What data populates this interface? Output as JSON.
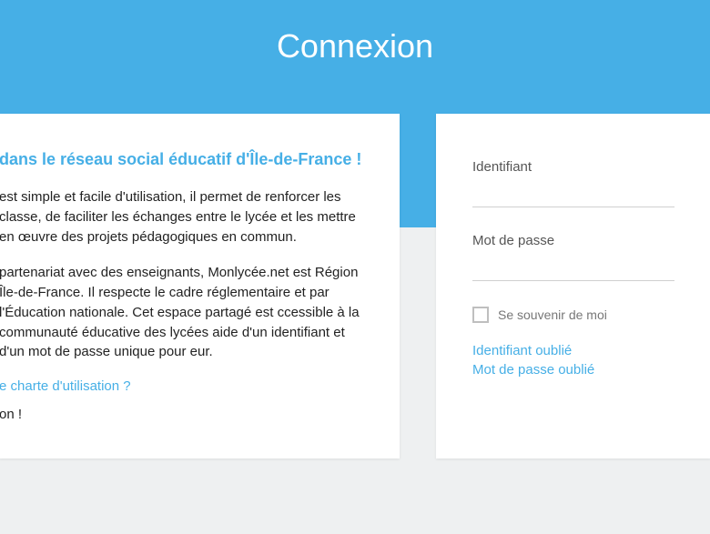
{
  "header": {
    "title": "Connexion"
  },
  "info": {
    "heading": "dans le réseau social éducatif d'Île-de-France !",
    "para1": "est simple et facile d'utilisation, il permet de renforcer les classe, de faciliter les échanges entre le lycée et les mettre en œuvre des projets pédagogiques en commun.",
    "para2": "partenariat avec des enseignants, Monlycée.net est Région Île-de-France. Il respecte le cadre réglementaire et par l'Éducation nationale. Cet espace partagé est ccessible à la communauté éducative des lycées aide d'un identifiant et d'un mot de passe unique pour eur.",
    "charter_link": "e charte d'utilisation ?",
    "closing": "on !"
  },
  "login": {
    "username_label": "Identifiant",
    "password_label": "Mot de passe",
    "remember_label": "Se souvenir de moi",
    "forgot_username": "Identifiant oublié",
    "forgot_password": "Mot de passe oublié"
  }
}
